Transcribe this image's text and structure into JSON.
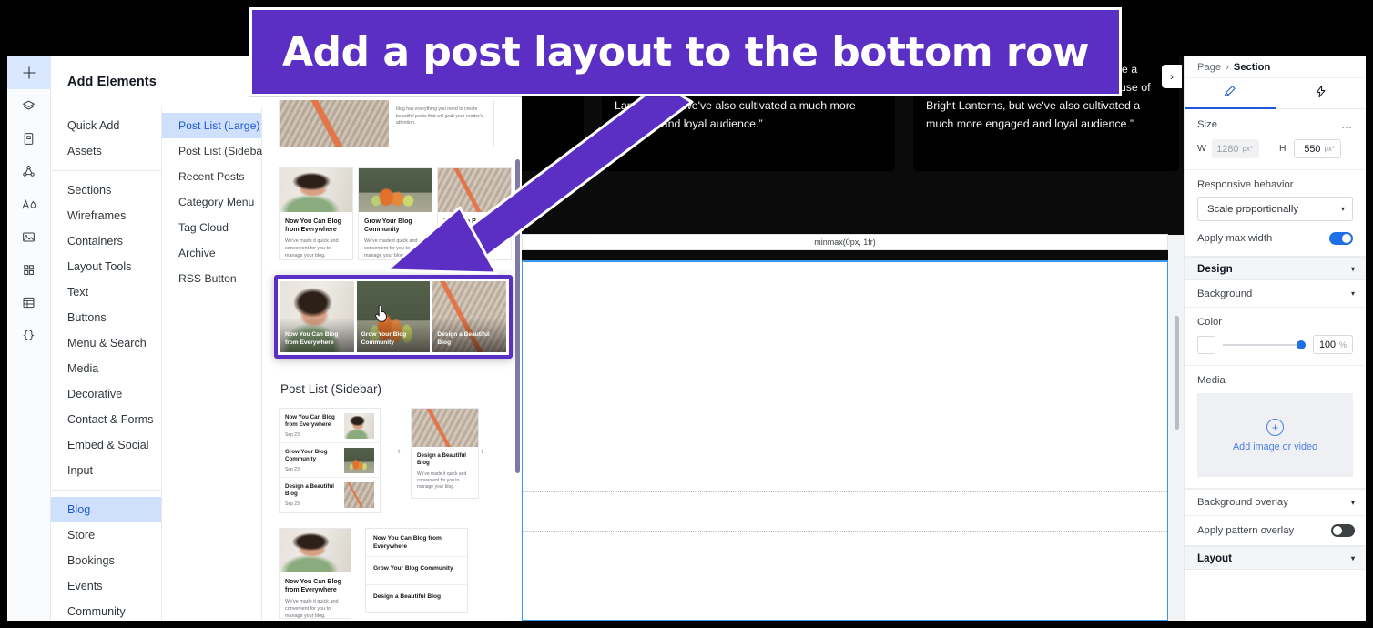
{
  "annotation": {
    "banner_text": "Add a post layout to the bottom row",
    "banner_color": "#5b2ec4",
    "arrow_color": "#5b2ec4"
  },
  "icon_rail": {
    "items": [
      {
        "name": "add-elements-icon",
        "glyph": "plus",
        "active": true
      },
      {
        "name": "layers-icon",
        "glyph": "layers",
        "active": false
      },
      {
        "name": "pages-icon",
        "glyph": "page",
        "active": false
      },
      {
        "name": "apps-icon",
        "glyph": "nodes",
        "active": false
      },
      {
        "name": "theme-icon",
        "glyph": "theme",
        "active": false
      },
      {
        "name": "media-icon",
        "glyph": "image",
        "active": false
      },
      {
        "name": "apps-market-icon",
        "glyph": "grid",
        "active": false
      },
      {
        "name": "cms-icon",
        "glyph": "table",
        "active": false
      },
      {
        "name": "dev-mode-icon",
        "glyph": "braces",
        "active": false
      }
    ]
  },
  "add_panel": {
    "title": "Add Elements",
    "quick_groups": [
      {
        "label": "Quick Add",
        "selected": false
      },
      {
        "label": "Assets",
        "selected": false
      }
    ],
    "categories": [
      {
        "label": "Sections",
        "selected": false
      },
      {
        "label": "Wireframes",
        "selected": false
      },
      {
        "label": "Containers",
        "selected": false
      },
      {
        "label": "Layout Tools",
        "selected": false
      },
      {
        "label": "Text",
        "selected": false
      },
      {
        "label": "Buttons",
        "selected": false
      },
      {
        "label": "Menu & Search",
        "selected": false
      },
      {
        "label": "Media",
        "selected": false
      },
      {
        "label": "Decorative",
        "selected": false
      },
      {
        "label": "Contact & Forms",
        "selected": false
      },
      {
        "label": "Embed & Social",
        "selected": false
      },
      {
        "label": "Input",
        "selected": false
      }
    ],
    "apps": [
      {
        "label": "Blog",
        "selected": true
      },
      {
        "label": "Store",
        "selected": false
      },
      {
        "label": "Bookings",
        "selected": false
      },
      {
        "label": "Events",
        "selected": false
      },
      {
        "label": "Community",
        "selected": false
      }
    ],
    "subcategories": [
      {
        "label": "Post List (Large)",
        "selected": true
      },
      {
        "label": "Post List (Sidebar)",
        "selected": false
      },
      {
        "label": "Recent Posts",
        "selected": false
      },
      {
        "label": "Category Menu",
        "selected": false
      },
      {
        "label": "Tag Cloud",
        "selected": false
      },
      {
        "label": "Archive",
        "selected": false
      },
      {
        "label": "RSS Button",
        "selected": false
      }
    ],
    "gallery": {
      "section_heading_2": "Post List (Sidebar)",
      "posts": [
        {
          "title": "Now You Can Blog from Everywhere",
          "body": "We've made it quick and convenient for you to manage your blog.",
          "date": "Sep 23"
        },
        {
          "title": "Grow Your Blog Community",
          "body": "We've made it quick and convenient for you to manage your blog.",
          "date": "Sep 23"
        },
        {
          "title": "Design a Beautiful Blog",
          "body": "We've made it quick and convenient for you to manage your blog.",
          "date": "Sep 23"
        }
      ],
      "top_card_body": "blog has everything you need to create beautiful posts that will grab your reader's attention.",
      "carousel_prev": "‹",
      "carousel_next": "›"
    }
  },
  "canvas": {
    "testimonial_text": "numbers have increased. Sure, we have a considerably larger following now because of Bright Lanterns, but we've also cultivated a much more engaged and loyal audience.”",
    "testimonial_left_fragments": [
      "have",
      "y",
      "'ve",
      "ed"
    ],
    "grid_track_label": "minmax(0px, 1fr)",
    "float_tools": {
      "help": "?",
      "more": "…"
    }
  },
  "inspector": {
    "breadcrumb": {
      "parent": "Page",
      "separator": "›",
      "current": "Section"
    },
    "tabs": [
      {
        "name": "design-tab",
        "icon": "brush-icon",
        "active": true
      },
      {
        "name": "interactions-tab",
        "icon": "lightning-icon",
        "active": false
      }
    ],
    "size": {
      "label": "Size",
      "more": "…",
      "width_label": "W",
      "width_value": "1280",
      "width_unit": "px*",
      "height_label": "H",
      "height_value": "550",
      "height_unit": "px*"
    },
    "responsive": {
      "label": "Responsive behavior",
      "value": "Scale proportionally"
    },
    "max_width": {
      "label": "Apply max width",
      "on": true
    },
    "design_section": {
      "label": "Design"
    },
    "background_section": {
      "label": "Background"
    },
    "color": {
      "label": "Color",
      "swatch": "#ffffff",
      "opacity": "100",
      "unit": "%"
    },
    "media": {
      "label": "Media",
      "add_label": "Add image or video",
      "plus": "+"
    },
    "background_overlay": {
      "label": "Background overlay"
    },
    "pattern_overlay": {
      "label": "Apply pattern overlay",
      "on": false
    },
    "layout_section": {
      "label": "Layout"
    },
    "collapse": {
      "icon": "chevron-right-icon",
      "glyph": "›"
    }
  },
  "colors": {
    "accent_blue": "#1f57d6",
    "selection_purple": "#5b2ec4",
    "toggle_on": "#1f6fe5",
    "canvas_dark": "#000000"
  }
}
